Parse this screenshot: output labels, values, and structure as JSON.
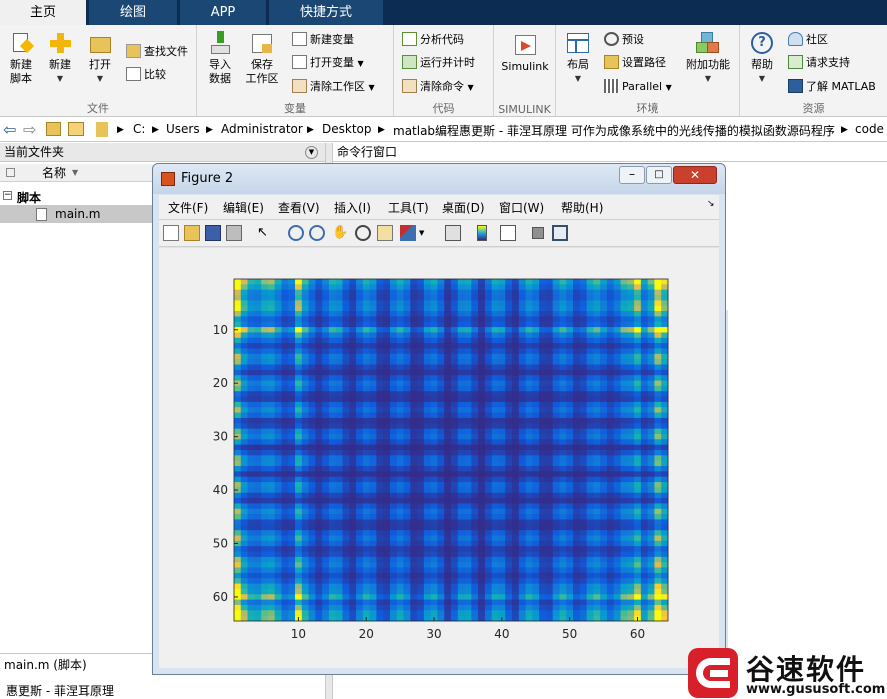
{
  "tabs": [
    {
      "label": "主页"
    },
    {
      "label": "绘图"
    },
    {
      "label": "APP"
    },
    {
      "label": "快捷方式"
    }
  ],
  "ribbon": {
    "file": {
      "label": "文件",
      "new_script": "新建\n脚本",
      "new": "新建",
      "open": "打开",
      "find_files": "查找文件",
      "compare": "比较"
    },
    "variable": {
      "label": "变量",
      "import": "导入\n数据",
      "save_ws": "保存\n工作区",
      "new_var": "新建变量",
      "open_var": "打开变量",
      "clear_ws": "清除工作区"
    },
    "code": {
      "label": "代码",
      "analyze": "分析代码",
      "run_time": "运行并计时",
      "clear_cmd": "清除命令"
    },
    "simulink": {
      "label": "SIMULINK",
      "btn": "Simulink"
    },
    "env": {
      "label": "环境",
      "layout": "布局",
      "prefs": "预设",
      "set_path": "设置路径",
      "parallel": "Parallel",
      "addons": "附加功能"
    },
    "resources": {
      "label": "资源",
      "help": "帮助",
      "community": "社区",
      "support": "请求支持",
      "learn": "了解 MATLAB"
    }
  },
  "path": [
    "C:",
    "Users",
    "Administrator",
    "Desktop",
    "matlab编程惠更斯 - 菲涅耳原理 可作为成像系统中的光线传播的模拟函数源码程序",
    "code"
  ],
  "current_folder": {
    "title": "当前文件夹",
    "col_name": "名称",
    "group": "脚本",
    "file": "main.m",
    "footer": "main.m (脚本)",
    "footer2": "惠更斯 - 菲涅耳原理"
  },
  "command_window": {
    "title": "命令行窗口"
  },
  "figure": {
    "title": "Figure 2",
    "menus": [
      "文件(F)",
      "编辑(E)",
      "查看(V)",
      "插入(I)",
      "工具(T)",
      "桌面(D)",
      "窗口(W)",
      "帮助(H)"
    ],
    "toolbar_icons": [
      "new-figure-icon",
      "open-file-icon",
      "save-icon",
      "print-icon",
      "pointer-icon",
      "zoom-in-icon",
      "zoom-out-icon",
      "pan-icon",
      "rotate-icon",
      "data-cursor-icon",
      "brush-icon",
      "link-icon",
      "colorbar-icon",
      "legend-icon",
      "hide-tools-icon",
      "show-tools-icon"
    ]
  },
  "chart_data": {
    "type": "heatmap",
    "title": "",
    "xlabel": "",
    "ylabel": "",
    "xticks": [
      10,
      20,
      30,
      40,
      50,
      60
    ],
    "yticks": [
      10,
      20,
      30,
      40,
      50,
      60
    ],
    "xlim": [
      0.5,
      64.5
    ],
    "ylim": [
      0.5,
      64.5
    ],
    "size": [
      64,
      64
    ],
    "colormap": "parula",
    "bright_rows": [
      10,
      60
    ],
    "bright_cols": [
      1,
      10,
      60,
      63
    ]
  },
  "watermark": {
    "brand": "谷速软件",
    "url": "www.gususoft.com"
  },
  "colors": {
    "tab_bg": "#0c2c52",
    "heat_low": "#352a87",
    "heat_high": "#f9fb0e"
  }
}
